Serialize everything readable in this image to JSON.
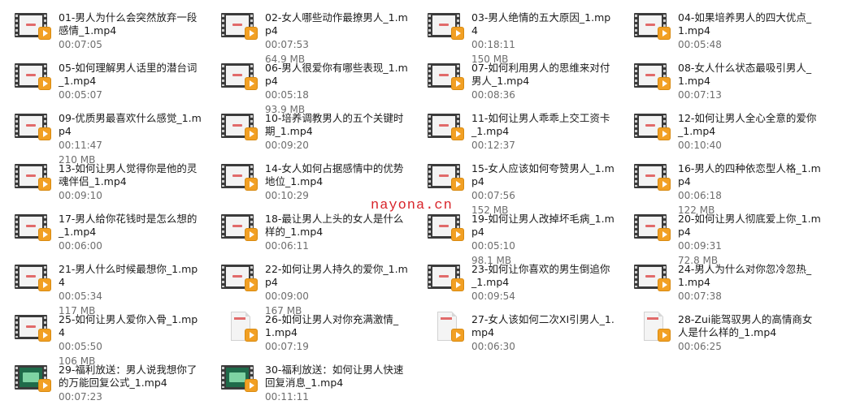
{
  "watermark": "nayona.cn",
  "files": [
    {
      "name": "01-男人为什么会突然放弃一段感情_1.mp4",
      "duration": "00:07:05",
      "size": "",
      "thumb": "film"
    },
    {
      "name": "02-女人哪些动作最撩男人_1.mp4",
      "duration": "00:07:53",
      "size": "64.9 MB",
      "thumb": "film"
    },
    {
      "name": "03-男人绝情的五大原因_1.mp4",
      "duration": "00:18:11",
      "size": "150 MB",
      "thumb": "film"
    },
    {
      "name": "04-如果培养男人的四大优点_1.mp4",
      "duration": "00:05:48",
      "size": "",
      "thumb": "film"
    },
    {
      "name": "05-如何理解男人话里的潜台词_1.mp4",
      "duration": "00:05:07",
      "size": "",
      "thumb": "film"
    },
    {
      "name": "06-男人很爱你有哪些表现_1.mp4",
      "duration": "00:05:18",
      "size": "93.9 MB",
      "thumb": "film"
    },
    {
      "name": "07-如何利用男人的思维来对付男人_1.mp4",
      "duration": "00:08:36",
      "size": "",
      "thumb": "film"
    },
    {
      "name": "08-女人什么状态最吸引男人_1.mp4",
      "duration": "00:07:13",
      "size": "",
      "thumb": "film"
    },
    {
      "name": "09-优质男最喜欢什么感觉_1.mp4",
      "duration": "00:11:47",
      "size": "210 MB",
      "thumb": "film"
    },
    {
      "name": "10-培养调教男人的五个关键时期_1.mp4",
      "duration": "00:09:20",
      "size": "",
      "thumb": "film"
    },
    {
      "name": "11-如何让男人乖乖上交工资卡_1.mp4",
      "duration": "00:12:37",
      "size": "",
      "thumb": "film"
    },
    {
      "name": "12-如何让男人全心全意的爱你_1.mp4",
      "duration": "00:10:40",
      "size": "",
      "thumb": "film"
    },
    {
      "name": "13-如何让男人觉得你是他的灵魂伴侣_1.mp4",
      "duration": "00:09:10",
      "size": "",
      "thumb": "film"
    },
    {
      "name": "14-女人如何占据感情中的优势地位_1.mp4",
      "duration": "00:10:29",
      "size": "",
      "thumb": "film"
    },
    {
      "name": "15-女人应该如何夸赞男人_1.mp4",
      "duration": "00:07:56",
      "size": "152 MB",
      "thumb": "film"
    },
    {
      "name": "16-男人的四种依恋型人格_1.mp4",
      "duration": "00:06:18",
      "size": "122 MB",
      "thumb": "film"
    },
    {
      "name": "17-男人给你花钱时是怎么想的_1.mp4",
      "duration": "00:06:00",
      "size": "",
      "thumb": "film"
    },
    {
      "name": "18-最让男人上头的女人是什么样的_1.mp4",
      "duration": "00:06:11",
      "size": "",
      "thumb": "film"
    },
    {
      "name": "19-如何让男人改掉坏毛病_1.mp4",
      "duration": "00:05:10",
      "size": "98.1 MB",
      "thumb": "film"
    },
    {
      "name": "20-如何让男人彻底爱上你_1.mp4",
      "duration": "00:09:31",
      "size": "72.8 MB",
      "thumb": "film"
    },
    {
      "name": "21-男人什么时候最想你_1.mp4",
      "duration": "00:05:34",
      "size": "117 MB",
      "thumb": "film"
    },
    {
      "name": "22-如何让男人持久的爱你_1.mp4",
      "duration": "00:09:00",
      "size": "167 MB",
      "thumb": "film"
    },
    {
      "name": "23-如何让你喜欢的男生倒追你_1.mp4",
      "duration": "00:09:54",
      "size": "",
      "thumb": "film"
    },
    {
      "name": "24-男人为什么对你忽冷忽热_1.mp4",
      "duration": "00:07:38",
      "size": "",
      "thumb": "film"
    },
    {
      "name": "25-如何让男人爱你入骨_1.mp4",
      "duration": "00:05:50",
      "size": "106 MB",
      "thumb": "film"
    },
    {
      "name": "26-如何让男人对你充满激情_1.mp4",
      "duration": "00:07:19",
      "size": "",
      "thumb": "paper"
    },
    {
      "name": "27-女人该如何二次XI引男人_1.mp4",
      "duration": "00:06:30",
      "size": "",
      "thumb": "paper"
    },
    {
      "name": "28-Zui能驾驭男人的高情商女人是什么样的_1.mp4",
      "duration": "00:06:25",
      "size": "",
      "thumb": "paper"
    },
    {
      "name": "29-福利放送：男人说我想你了的万能回复公式_1.mp4",
      "duration": "00:07:23",
      "size": "",
      "thumb": "film-green"
    },
    {
      "name": "30-福利放送：如何让男人快速回复消息_1.mp4",
      "duration": "00:11:11",
      "size": "",
      "thumb": "film-green"
    }
  ]
}
